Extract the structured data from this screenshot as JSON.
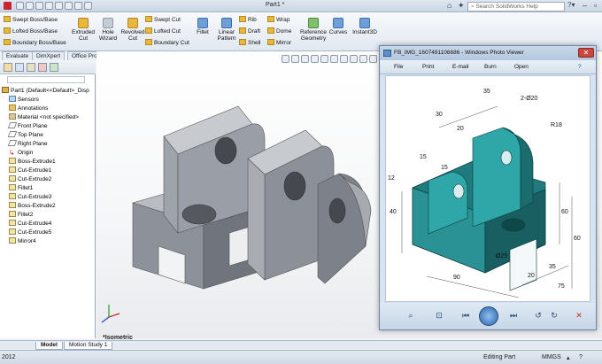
{
  "app": {
    "document_title": "Part1 *",
    "search_placeholder": "Search SolidWorks Help",
    "version_fragment": "2012"
  },
  "ribbon": {
    "small_left": [
      "Swept Boss/Base",
      "Lofted Boss/Base",
      "Boundary Boss/Base"
    ],
    "extruded_cut": "Extruded Cut",
    "hole_wizard": "Hole Wizard",
    "revolved_cut": "Revolved Cut",
    "small_cut": [
      "Swept Cut",
      "Lofted Cut",
      "Boundary Cut"
    ],
    "fillet": "Fillet",
    "linear_pattern": "Linear Pattern",
    "small_features": [
      "Rib",
      "Draft",
      "Shell"
    ],
    "small_features2": [
      "Wrap",
      "Dome",
      "Mirror"
    ],
    "reference_geometry": "Reference Geometry",
    "curves": "Curves",
    "instant3d": "Instant3D"
  },
  "command_tabs": [
    "Evaluate",
    "DimXpert",
    "Office Products"
  ],
  "tree": [
    {
      "label": "Part1  (Default<<Default>_Disp",
      "icon": "part-icon"
    },
    {
      "label": "Sensors",
      "icon": "sensor-icon"
    },
    {
      "label": "Annotations",
      "icon": "annotation-icon"
    },
    {
      "label": "Material <not specified>",
      "icon": "material-icon"
    },
    {
      "label": "Front Plane",
      "icon": "plane-icon"
    },
    {
      "label": "Top Plane",
      "icon": "plane-icon"
    },
    {
      "label": "Right Plane",
      "icon": "plane-icon"
    },
    {
      "label": "Origin",
      "icon": "origin-icon"
    },
    {
      "label": "Boss-Extrude1",
      "icon": "feature-icon"
    },
    {
      "label": "Cut-Extrude1",
      "icon": "feature-icon"
    },
    {
      "label": "Cut-Extrude2",
      "icon": "feature-icon"
    },
    {
      "label": "Fillet1",
      "icon": "feature-icon"
    },
    {
      "label": "Cut-Extrude3",
      "icon": "feature-icon"
    },
    {
      "label": "Boss-Extrude2",
      "icon": "feature-icon"
    },
    {
      "label": "Fillet2",
      "icon": "feature-icon"
    },
    {
      "label": "Cut-Extrude4",
      "icon": "feature-icon"
    },
    {
      "label": "Cut-Extrude5",
      "icon": "feature-icon"
    },
    {
      "label": "Mirror4",
      "icon": "feature-icon"
    }
  ],
  "viewport": {
    "view_label": "*Isometric"
  },
  "bottom_tabs": [
    "Model",
    "Motion Study 1"
  ],
  "status": {
    "editing": "Editing Part",
    "units": "MMGS"
  },
  "photo_viewer": {
    "title": "FB_IMG_1607491106686 - Windows Photo Viewer",
    "menu": [
      "File",
      "Print",
      "E-mail",
      "Burn",
      "Open"
    ],
    "drawing_labels": [
      "35",
      "2-Ø20",
      "R18",
      "30",
      "20",
      "15",
      "12",
      "15",
      "40",
      "60",
      "60",
      "90",
      "Ø25",
      "20",
      "35",
      "75"
    ]
  },
  "colors": {
    "accent_teal": "#2a8c8c",
    "model_gray": "#8f949c"
  }
}
